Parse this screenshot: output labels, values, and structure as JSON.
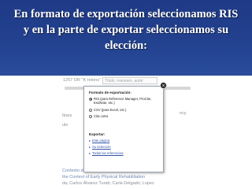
{
  "slide": {
    "title_line1": "En formato de exportación seleccionamos RIS",
    "title_line2": "y en la parte de exportar seleccionamos su",
    "title_line3": "elección:"
  },
  "background_page": {
    "search_placeholder": "Título, resumen, autor",
    "side_text_1": "Ibars",
    "side_text_2": "ulo",
    "side_text_3": "ncy",
    "bottom_line_1": "Contexto de la rehabilitación física temprana",
    "bottom_line_2": "the Context of Early Physical Rehabilitation",
    "bottom_line_3": "da; Carlos Álvarez Turab; Carla Delgado; Lopez",
    "header_text": "1257 OR \"K rotons\""
  },
  "dialog": {
    "format_title": "Formato de exportación:",
    "options": [
      {
        "label": "RIS (para Reference Manager, ProCite, EndNote, etc.)",
        "selected": true
      },
      {
        "label": "CSV (para Excel, etc.)",
        "selected": false
      },
      {
        "label": "Cita corta",
        "selected": false
      }
    ],
    "export_title": "Exportar:",
    "export_links": [
      "Este página",
      "Su selección",
      "Todas las referencias"
    ]
  },
  "colors": {
    "title_bg": "#22418f",
    "title_text": "#ffffff",
    "link": "#3355aa"
  }
}
